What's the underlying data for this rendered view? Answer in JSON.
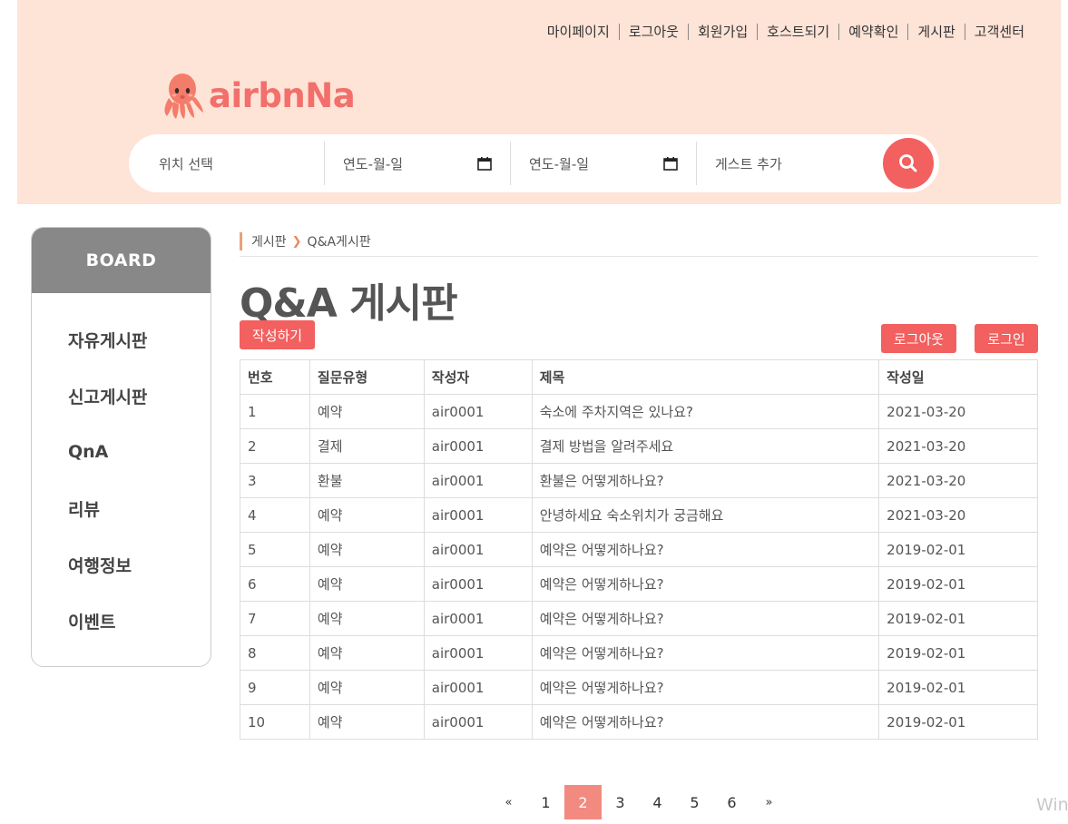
{
  "topnav": [
    "마이페이지",
    "로그아웃",
    "회원가입",
    "호스트되기",
    "예약확인",
    "게시판",
    "고객센터"
  ],
  "logo": {
    "text": "airbnNa"
  },
  "search": {
    "location": "위치 선택",
    "checkin": "연도-월-일",
    "checkout": "연도-월-일",
    "guests": "게스트 추가"
  },
  "sidebar": {
    "title": "BOARD",
    "items": [
      "자유게시판",
      "신고게시판",
      "QnA",
      "리뷰",
      "여행정보",
      "이벤트"
    ]
  },
  "breadcrumb": {
    "parent": "게시판",
    "current": "Q&A게시판"
  },
  "page_title": "Q&A 게시판",
  "buttons": {
    "write": "작성하기",
    "logout": "로그아웃",
    "login": "로그인"
  },
  "table": {
    "headers": [
      "번호",
      "질문유형",
      "작성자",
      "제목",
      "작성일"
    ],
    "rows": [
      [
        "1",
        "예약",
        "air0001",
        "숙소에 주차지역은 있나요?",
        "2021-03-20"
      ],
      [
        "2",
        "결제",
        "air0001",
        "결제 방법을 알려주세요",
        "2021-03-20"
      ],
      [
        "3",
        "환불",
        "air0001",
        "환불은 어떻게하나요?",
        "2021-03-20"
      ],
      [
        "4",
        "예약",
        "air0001",
        "안녕하세요 숙소위치가 궁금해요",
        "2021-03-20"
      ],
      [
        "5",
        "예약",
        "air0001",
        "예약은 어떻게하나요?",
        "2019-02-01"
      ],
      [
        "6",
        "예약",
        "air0001",
        "예약은 어떻게하나요?",
        "2019-02-01"
      ],
      [
        "7",
        "예약",
        "air0001",
        "예약은 어떻게하나요?",
        "2019-02-01"
      ],
      [
        "8",
        "예약",
        "air0001",
        "예약은 어떻게하나요?",
        "2019-02-01"
      ],
      [
        "9",
        "예약",
        "air0001",
        "예약은 어떻게하나요?",
        "2019-02-01"
      ],
      [
        "10",
        "예약",
        "air0001",
        "예약은 어떻게하나요?",
        "2019-02-01"
      ]
    ]
  },
  "pagination": {
    "prev": "«",
    "pages": [
      "1",
      "2",
      "3",
      "4",
      "5",
      "6"
    ],
    "next": "»",
    "active": "2"
  },
  "watermark": "Win",
  "colors": {
    "accent": "#f2605f",
    "header_bg": "#fee3d7",
    "sidebar_head": "#888888"
  }
}
